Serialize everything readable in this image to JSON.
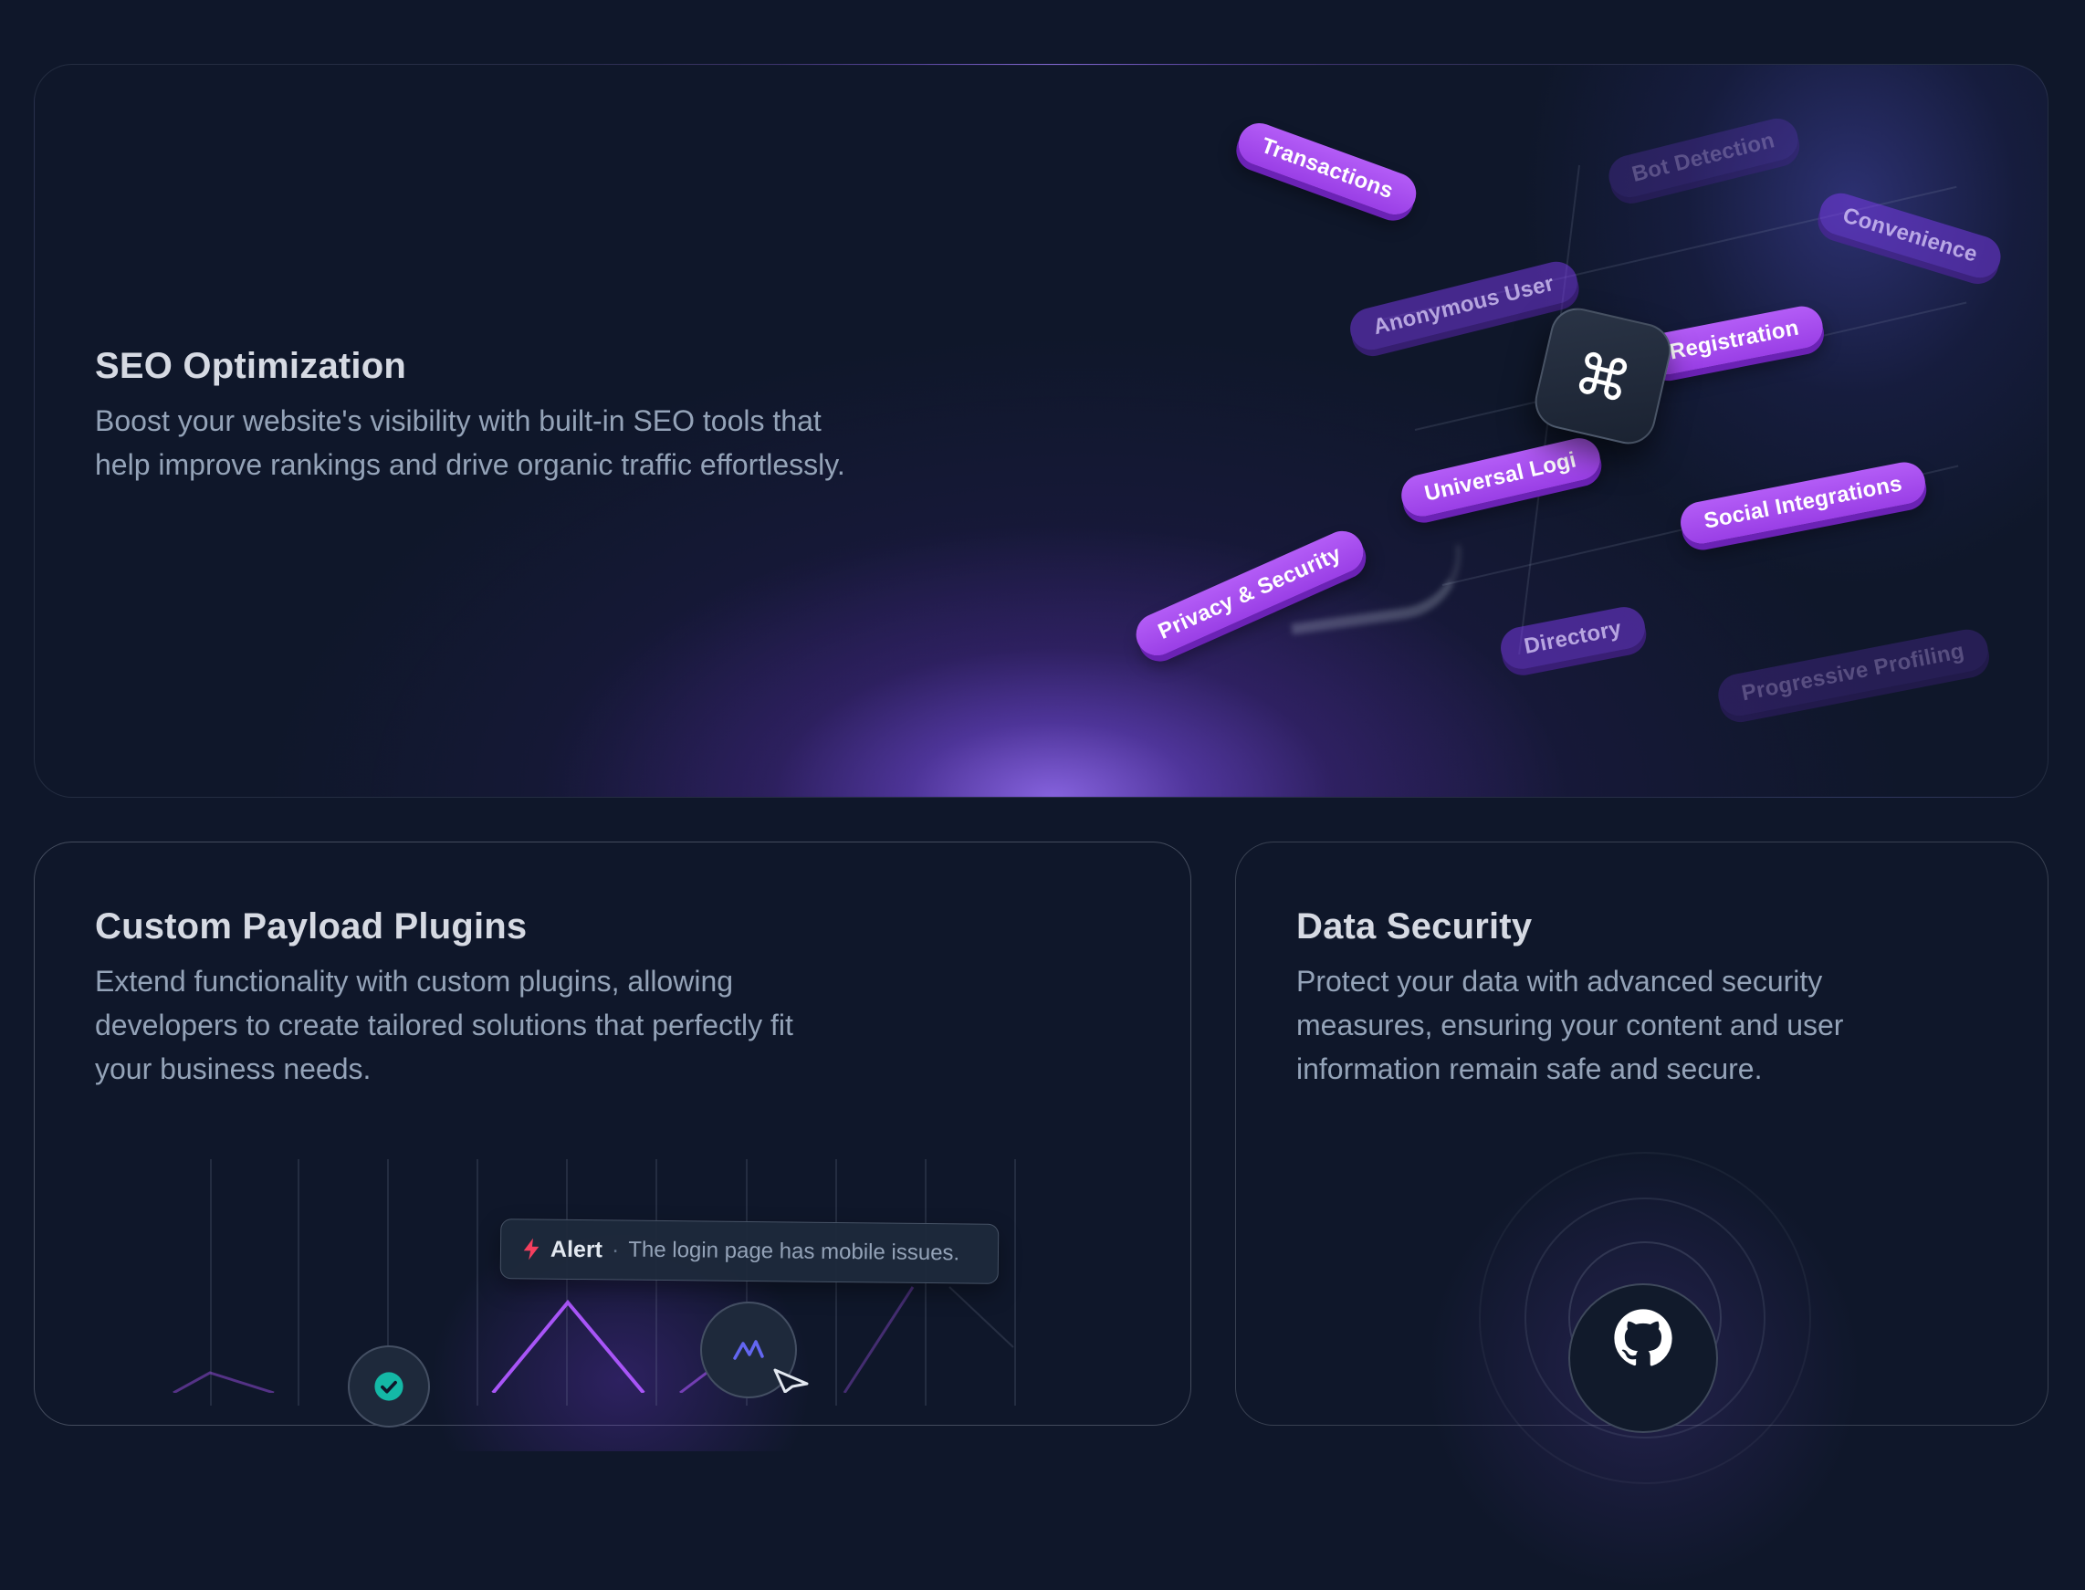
{
  "seo": {
    "title": "SEO Optimization",
    "description_line1": "Boost your website's visibility with built-in SEO tools that",
    "description_line2": "help improve rankings and drive organic traffic effortlessly.",
    "chips": {
      "transactions": "Transactions",
      "bot_detection": "Bot Detection",
      "convenience": "Convenience",
      "anonymous_user": "Anonymous User",
      "registration": "Registration",
      "universal_login": "Universal Logi",
      "social_integrations": "Social Integrations",
      "privacy_security": "Privacy & Security",
      "directory": "Directory",
      "progressive_profiling": "Progressive Profiling"
    },
    "center_icon": "command-icon"
  },
  "plugins": {
    "title": "Custom Payload Plugins",
    "description_line1": "Extend functionality with custom plugins, allowing",
    "description_line2": "developers to create tailored solutions that perfectly fit",
    "description_line3": "your business needs.",
    "alert": {
      "icon": "lightning-icon",
      "label": "Alert",
      "separator": "·",
      "message": "The login page has mobile issues."
    },
    "colors": {
      "accent": "#a855f7",
      "check": "#14b8a6",
      "alert": "#f43f5e"
    }
  },
  "security": {
    "title": "Data Security",
    "description_line1": "Protect your data with advanced security",
    "description_line2": "measures, ensuring your content and user",
    "description_line3": "information remain safe and secure.",
    "center_icon": "github-icon"
  }
}
